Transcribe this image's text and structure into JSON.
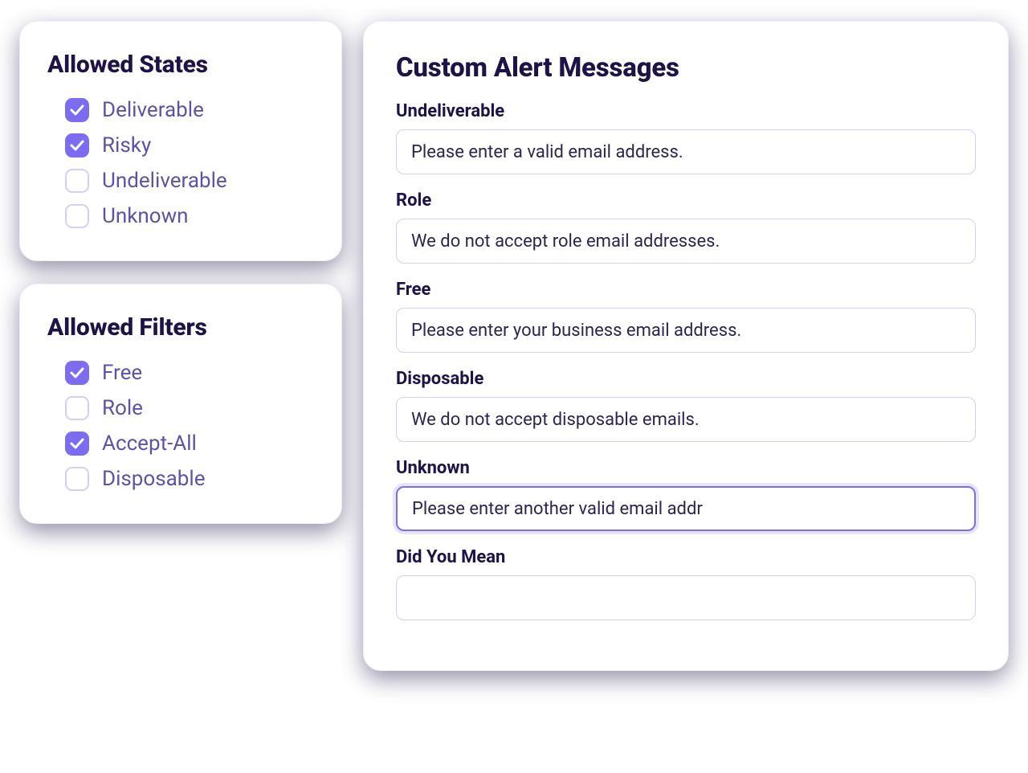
{
  "states": {
    "title": "Allowed States",
    "items": [
      {
        "label": "Deliverable",
        "checked": true
      },
      {
        "label": "Risky",
        "checked": true
      },
      {
        "label": "Undeliverable",
        "checked": false
      },
      {
        "label": "Unknown",
        "checked": false
      }
    ]
  },
  "filters": {
    "title": "Allowed Filters",
    "items": [
      {
        "label": "Free",
        "checked": true
      },
      {
        "label": "Role",
        "checked": false
      },
      {
        "label": "Accept-All",
        "checked": true
      },
      {
        "label": "Disposable",
        "checked": false
      }
    ]
  },
  "alerts": {
    "title": "Custom Alert Messages",
    "fields": [
      {
        "label": "Undeliverable",
        "value": "Please enter a valid email address.",
        "focused": false
      },
      {
        "label": "Role",
        "value": "We do not accept role email addresses.",
        "focused": false
      },
      {
        "label": "Free",
        "value": "Please enter your business email address.",
        "focused": false
      },
      {
        "label": "Disposable",
        "value": "We do not accept disposable emails.",
        "focused": false
      },
      {
        "label": "Unknown",
        "value": "Please enter another valid email addr",
        "focused": true
      },
      {
        "label": "Did You Mean",
        "value": "",
        "focused": false
      }
    ]
  }
}
